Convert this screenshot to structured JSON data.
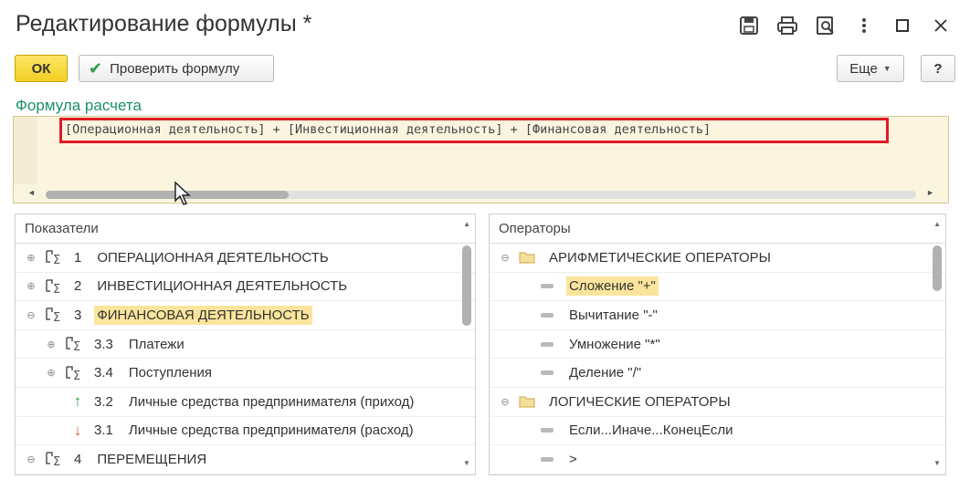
{
  "window": {
    "title": "Редактирование формулы *",
    "icons": [
      "save-icon",
      "print-icon",
      "preview-icon",
      "more-vertical-icon",
      "maximize-icon",
      "close-icon"
    ]
  },
  "toolbar": {
    "ok_label": "ОК",
    "check_label": "Проверить формулу",
    "more_label": "Еще",
    "help_label": "?"
  },
  "formula": {
    "label": "Формула расчета",
    "text": "[Операционная деятельность] + [Инвестиционная деятельность] + [Финансовая деятельность]",
    "scroll_position": 0.28
  },
  "indicators": {
    "header": "Показатели",
    "rows": [
      {
        "toggle": "⊕",
        "num": "1",
        "label": "ОПЕРАЦИОННАЯ ДЕЯТЕЛЬНОСТЬ",
        "highlight": false
      },
      {
        "toggle": "⊕",
        "num": "2",
        "label": "ИНВЕСТИЦИОННАЯ ДЕЯТЕЛЬНОСТЬ",
        "highlight": false
      },
      {
        "toggle": "⊖",
        "num": "3",
        "label": "ФИНАНСОВАЯ ДЕЯТЕЛЬНОСТЬ",
        "highlight": true
      },
      {
        "toggle": "⊕",
        "num": "3.3",
        "label": "Платежи",
        "highlight": false
      },
      {
        "toggle": "⊕",
        "num": "3.4",
        "label": "Поступления",
        "highlight": false
      },
      {
        "num": "3.2",
        "label": "Личные средства предпринимателя (приход)"
      },
      {
        "num": "3.1",
        "label": "Личные средства предпринимателя (расход)"
      },
      {
        "toggle": "⊖",
        "num": "4",
        "label": "ПЕРЕМЕЩЕНИЯ",
        "highlight": false
      }
    ]
  },
  "operators": {
    "header": "Операторы",
    "rows": [
      {
        "toggle": "⊖",
        "label": "АРИФМЕТИЧЕСКИЕ ОПЕРАТОРЫ"
      },
      {
        "label": "Сложение \"+\"",
        "highlight": true
      },
      {
        "label": "Вычитание \"-\""
      },
      {
        "label": "Умножение \"*\""
      },
      {
        "label": "Деление \"/\""
      },
      {
        "toggle": "⊖",
        "label": "ЛОГИЧЕСКИЕ ОПЕРАТОРЫ"
      },
      {
        "label": "Если...Иначе...КонецЕсли"
      },
      {
        "label": ">"
      }
    ]
  },
  "colors": {
    "ok_button": "#f3cf23",
    "formula_label": "#1b8f69",
    "highlight": "#fbe59c",
    "frame": "#e01b24",
    "editor_bg": "#fbf5e0",
    "arrow_in": "#27a046",
    "arrow_out": "#e0523a"
  }
}
